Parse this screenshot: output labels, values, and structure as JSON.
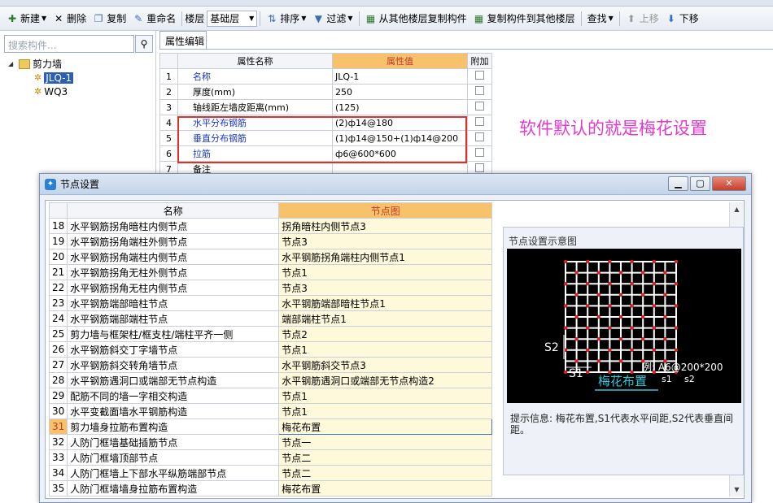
{
  "toolbar": {
    "new_label": "新建",
    "delete_label": "删除",
    "copy_label": "复制",
    "rename_label": "重命名",
    "floor_label": "楼层",
    "floor_value": "基础层",
    "sort_label": "排序",
    "filter_label": "过滤",
    "copy_from_floor_label": "从其他楼层复制构件",
    "copy_to_floor_label": "复制构件到其他楼层",
    "find_label": "查找",
    "move_up_label": "上移",
    "move_down_label": "下移"
  },
  "left_panel": {
    "search_placeholder": "搜索构件...",
    "tree": {
      "root_label": "剪力墙",
      "children": [
        "JLQ-1",
        "WQ3"
      ]
    }
  },
  "property_editor": {
    "tab_label": "属性编辑",
    "headers": [
      "属性名称",
      "属性值",
      "附加"
    ],
    "rows": [
      {
        "num": "1",
        "name": "名称",
        "value": "JLQ-1",
        "blue": true
      },
      {
        "num": "2",
        "name": "厚度(mm)",
        "value": "250",
        "blue": false
      },
      {
        "num": "3",
        "name": "轴线距左墙皮距离(mm)",
        "value": "(125)",
        "blue": false
      },
      {
        "num": "4",
        "name": "水平分布钢筋",
        "value": "(2)ф14@180",
        "blue": true
      },
      {
        "num": "5",
        "name": "垂直分布钢筋",
        "value": "(1)ф14@150+(1)ф14@200",
        "blue": true
      },
      {
        "num": "6",
        "name": "拉筋",
        "value": "ф6@600*600",
        "blue": true
      },
      {
        "num": "7",
        "name": "备注",
        "value": "",
        "blue": false
      }
    ]
  },
  "annotation_text": "软件默认的就是梅花设置",
  "node_dialog": {
    "title": "节点设置",
    "headers": [
      "名称",
      "节点图"
    ],
    "rows": [
      {
        "num": "18",
        "name": "水平钢筋拐角暗柱内侧节点",
        "value": "拐角暗柱内侧节点3"
      },
      {
        "num": "19",
        "name": "水平钢筋拐角端柱外侧节点",
        "value": "节点3"
      },
      {
        "num": "20",
        "name": "水平钢筋拐角端柱内侧节点",
        "value": "水平钢筋拐角端柱内侧节点1"
      },
      {
        "num": "21",
        "name": "水平钢筋拐角无柱外侧节点",
        "value": "节点1"
      },
      {
        "num": "22",
        "name": "水平钢筋拐角无柱内侧节点",
        "value": "节点3"
      },
      {
        "num": "23",
        "name": "水平钢筋端部暗柱节点",
        "value": "水平钢筋端部暗柱节点1"
      },
      {
        "num": "24",
        "name": "水平钢筋端部端柱节点",
        "value": "端部端柱节点1"
      },
      {
        "num": "25",
        "name": "剪力墙与框架柱/框支柱/端柱平齐一侧",
        "value": "节点2"
      },
      {
        "num": "26",
        "name": "水平钢筋斜交丁字墙节点",
        "value": "节点1"
      },
      {
        "num": "27",
        "name": "水平钢筋斜交转角墙节点",
        "value": "水平钢筋斜交节点3"
      },
      {
        "num": "28",
        "name": "水平钢筋遇洞口或端部无节点构造",
        "value": "水平钢筋遇洞口或端部无节点构造2"
      },
      {
        "num": "29",
        "name": "配筋不同的墙一字相交构造",
        "value": "节点1"
      },
      {
        "num": "30",
        "name": "水平变截面墙水平钢筋构造",
        "value": "节点1"
      },
      {
        "num": "31",
        "name": "剪力墙身拉筋布置构造",
        "value": "梅花布置",
        "selected": true
      },
      {
        "num": "32",
        "name": "人防门框墙基础插筋节点",
        "value": "节点一"
      },
      {
        "num": "33",
        "name": "人防门框墙顶部节点",
        "value": "节点二"
      },
      {
        "num": "34",
        "name": "人防门框墙上下部水平纵筋端部节点",
        "value": "节点二"
      },
      {
        "num": "35",
        "name": "人防门框墙墙身拉筋布置构造",
        "value": "梅花布置"
      }
    ],
    "preview": {
      "title": "节点设置示意图",
      "s2_label": "S2",
      "s1_label": "S1",
      "example_label": "例: A6@200*200",
      "caption": "梅花布置",
      "s1_small": "s1",
      "s2_small": "s2",
      "tip_label": "提示信息:",
      "tip_text": "梅花布置,S1代表水平间距,S2代表垂直间距。"
    }
  },
  "colors": {
    "accent_header": "#f7c26b",
    "annotation": "#e23ad0",
    "highlight_frame": "#e0302a",
    "link_blue": "#1a36c8"
  }
}
